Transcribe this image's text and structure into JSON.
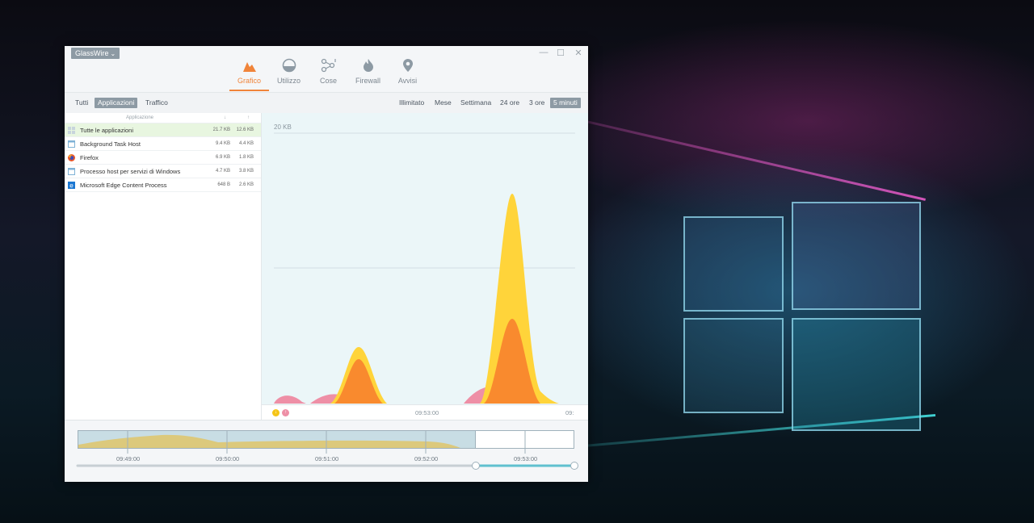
{
  "app": {
    "title": "GlassWire",
    "window_controls": {
      "minimize": "—",
      "maximize": "☐",
      "close": "✕"
    }
  },
  "nav": {
    "tabs": [
      {
        "label": "Grafico",
        "icon": "graph-icon",
        "active": true
      },
      {
        "label": "Utilizzo",
        "icon": "usage-icon"
      },
      {
        "label": "Cose",
        "icon": "things-icon"
      },
      {
        "label": "Firewall",
        "icon": "fire-icon"
      },
      {
        "label": "Avvisi",
        "icon": "alert-pin-icon"
      }
    ]
  },
  "filters": {
    "left": [
      "Tutti",
      "Applicazioni",
      "Traffico"
    ],
    "left_selected": "Applicazioni",
    "right": [
      "Illimitato",
      "Mese",
      "Settimana",
      "24 ore",
      "3 ore",
      "5 minuti"
    ],
    "right_selected": "5 minuti"
  },
  "app_list": {
    "header": {
      "name": "Applicazione",
      "down": "↓",
      "up": "↑"
    },
    "rows": [
      {
        "name": "Tutte le applicazioni",
        "down": "21.7 KB",
        "up": "12.6 KB",
        "icon": "all-apps-icon",
        "selected": true
      },
      {
        "name": "Background Task Host",
        "down": "9.4 KB",
        "up": "4.4 KB",
        "icon": "window-app-icon"
      },
      {
        "name": "Firefox",
        "down": "6.9 KB",
        "up": "1.8 KB",
        "icon": "firefox-icon"
      },
      {
        "name": "Processo host per servizi di Windows",
        "down": "4.7 KB",
        "up": "3.8 KB",
        "icon": "window-app-icon"
      },
      {
        "name": "Microsoft Edge Content Process",
        "down": "648 B",
        "up": "2.6 KB",
        "icon": "edge-icon"
      }
    ]
  },
  "graph": {
    "y_label": "20 KB",
    "time_label": "09:53:00",
    "time_label_right": "09:",
    "legend": {
      "down_icon": "↓",
      "up_icon": "↑"
    },
    "colors": {
      "download": "#ffd43a",
      "upload": "#f98a2e",
      "other": "#ee8fa6",
      "background": "#ebf6f8"
    }
  },
  "timeline": {
    "ticks": [
      "09:49:00",
      "09:50:00",
      "09:51:00",
      "09:52:00",
      "09:53:00"
    ]
  }
}
